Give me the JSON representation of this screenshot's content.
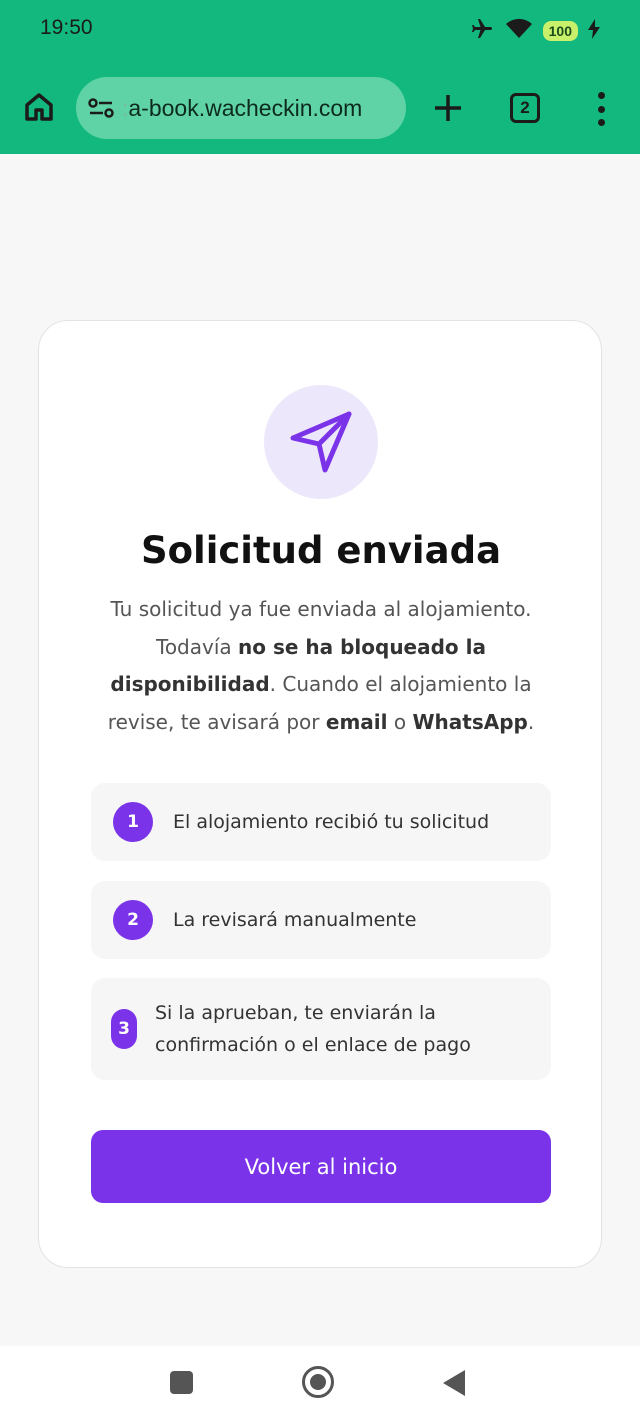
{
  "status_bar": {
    "time": "19:50",
    "battery": "100",
    "icons": [
      "airplane-icon",
      "wifi-icon",
      "battery-icon",
      "charging-icon"
    ]
  },
  "browser": {
    "url_prefix": "a-book.wacheckin.com",
    "url_faded": ":",
    "tab_count": "2"
  },
  "main": {
    "title": "Solicitud enviada",
    "description_parts": {
      "p1": "Tu solicitud ya fue enviada al alojamiento. Todavía ",
      "b1": "no se ha bloqueado la disponibilidad",
      "p2": ". Cuando el alojamiento la revise, te avisará por ",
      "b2": "email",
      "p3": " o ",
      "b3": "WhatsApp",
      "p4": "."
    },
    "steps": [
      {
        "num": "1",
        "text": "El alojamiento recibió tu solicitud"
      },
      {
        "num": "2",
        "text": "La revisará manualmente"
      },
      {
        "num": "3",
        "text": "Si la aprueban, te enviarán la confirmación o el enlace de pago"
      }
    ],
    "cta_label": "Volver al inicio"
  },
  "colors": {
    "browser_green": "#12b87e",
    "accent_purple": "#7a33e8",
    "icon_bg": "#ede7fb"
  }
}
